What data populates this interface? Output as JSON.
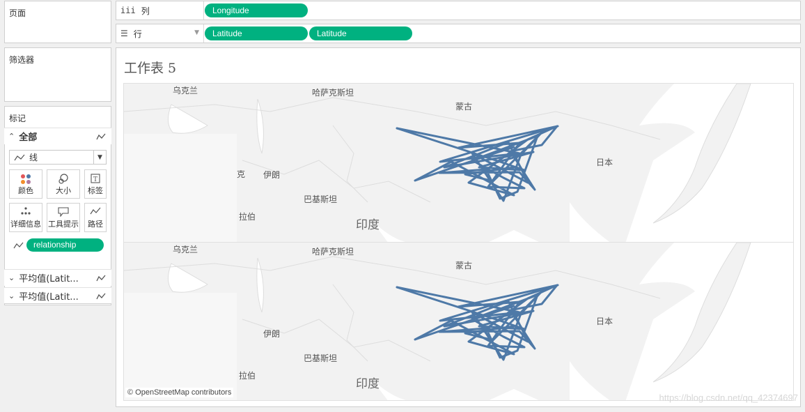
{
  "left": {
    "pages_title": "页面",
    "filters_title": "筛选器",
    "marks_title": "标记",
    "all_label": "全部",
    "mark_type": "线",
    "buttons": {
      "color": "颜色",
      "size": "大小",
      "label": "标签",
      "detail": "详细信息",
      "tooltip": "工具提示",
      "path": "路径"
    },
    "relationship_pill": "relationship",
    "avg_sections": [
      "平均值(Latit...",
      "平均值(Latit..."
    ]
  },
  "shelves": {
    "columns_icon": "iii",
    "columns_label": "列",
    "columns_pill": "Longitude",
    "rows_icon": "☰",
    "rows_label": "行",
    "rows_pills": [
      "Latitude",
      "Latitude"
    ]
  },
  "sheet": {
    "title": "工作表 5",
    "map_labels": {
      "ukraine": "乌克兰",
      "kazakhstan": "哈萨克斯坦",
      "mongolia": "蒙古",
      "iran": "伊朗",
      "japan": "日本",
      "pakistan": "巴基斯坦",
      "arabia": "拉伯",
      "india": "印度",
      "k_fragment": "克"
    },
    "attribution": "© OpenStreetMap contributors"
  },
  "colors": {
    "pill": "#00b180",
    "line": "#4e79a7",
    "map_bg": "#f2f2f2"
  },
  "watermark": "https://blog.csdn.net/qq_42374697"
}
